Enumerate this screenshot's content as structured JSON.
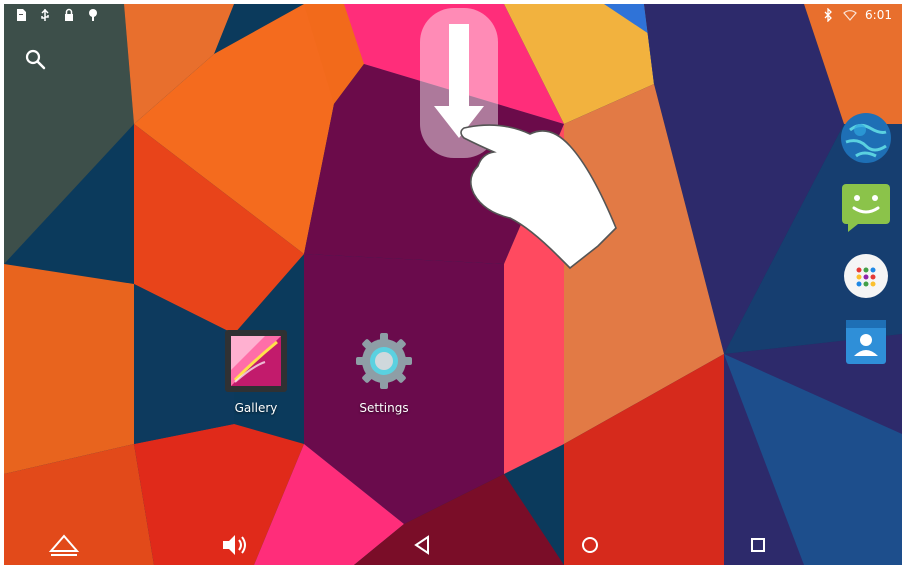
{
  "status_bar": {
    "left_icons": [
      "sd-card-icon",
      "usb-icon",
      "lock-icon",
      "notification-icon"
    ],
    "right_icons": [
      "bluetooth-icon",
      "wifi-icon"
    ],
    "time": "6:01"
  },
  "search": {
    "icon": "search-icon"
  },
  "apps": [
    {
      "label": "Gallery",
      "icon": "gallery-icon"
    },
    {
      "label": "Settings",
      "icon": "settings-gear-icon"
    }
  ],
  "dock": [
    "browser-globe-icon",
    "messaging-icon",
    "app-drawer-icon",
    "contacts-icon"
  ],
  "nav_bar": [
    "home-icon",
    "volume-icon",
    "back-icon",
    "home-circle-icon",
    "recent-apps-icon"
  ],
  "gesture_hint": {
    "icon": "swipe-down-arrow-icon",
    "hand": "pointing-hand-icon"
  },
  "colors": {
    "accent_orange": "#f26a1b",
    "navy": "#0b3a5c",
    "magenta": "#ff2d7a",
    "green": "#8bc34a",
    "blue": "#2f8fd8"
  }
}
